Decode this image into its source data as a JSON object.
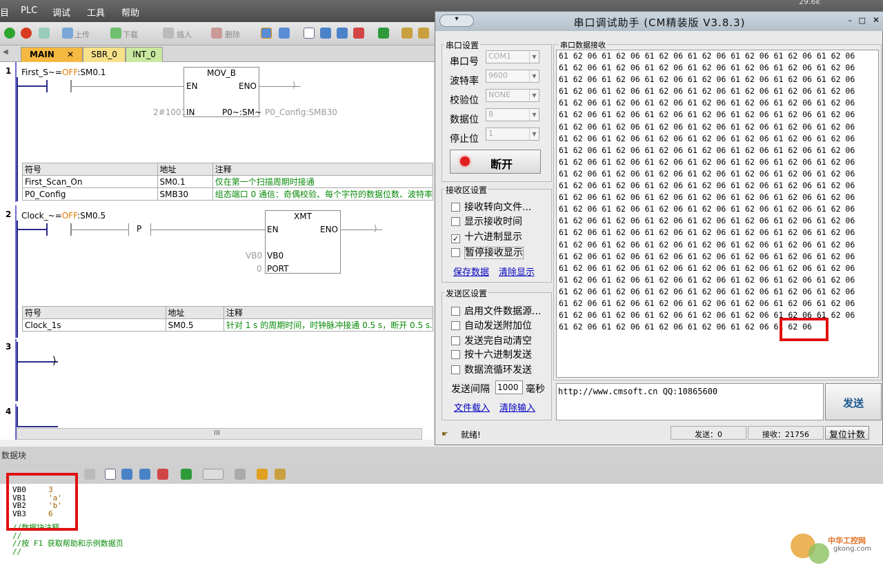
{
  "menu": {
    "partial_left": "目",
    "items": [
      "PLC",
      "调试",
      "工具",
      "帮助"
    ],
    "overlay_value": "29.6k"
  },
  "toolbar": {
    "upload": "上传",
    "download": "下载",
    "insert": "插入",
    "delete": "删除"
  },
  "tabs": [
    "MAIN",
    "SBR_0",
    "INT_0"
  ],
  "networks": [
    {
      "number": "1",
      "contact": "First_S~=OFF:SM0.1",
      "block": "MOV_B",
      "en": "EN",
      "eno": "ENO",
      "in_value": "2#1001",
      "in_pin": "IN",
      "out_pin": "P0~:SM~",
      "out_value": "P0_Config:SMB30",
      "symbols": {
        "headers": [
          "符号",
          "地址",
          "注释"
        ],
        "rows": [
          [
            "First_Scan_On",
            "SM0.1",
            "仅在第一个扫描周期时接通"
          ],
          [
            "P0_Config",
            "SMB30",
            "组态端口 0 通信：奇偶校验、每个字符的数据位数、波特率"
          ]
        ]
      }
    },
    {
      "number": "2",
      "contact": "Clock_~=OFF:SM0.5",
      "edge": "P",
      "block": "XMT",
      "en": "EN",
      "eno": "ENO",
      "in1_value": "VB0",
      "in1_pin": "VB0",
      "in2_value": "0",
      "in2_pin": "PORT",
      "symbols": {
        "headers": [
          "符号",
          "地址",
          "注释"
        ],
        "rows": [
          [
            "Clock_1s",
            "SM0.5",
            "针对 1 s 的周期时间，时钟脉冲接通 0.5 s，断开 0.5 s."
          ]
        ]
      }
    },
    {
      "number": "3"
    },
    {
      "number": "4"
    }
  ],
  "scrollbar_grip": "III",
  "datablock": {
    "title": "数据块",
    "lines": [
      {
        "addr": "VB0",
        "val": "3"
      },
      {
        "addr": "VB1",
        "val": "'a'"
      },
      {
        "addr": "VB2",
        "val": "'b'"
      },
      {
        "addr": "VB3",
        "val": "6"
      }
    ],
    "comments": [
      "//数据块注释",
      "//",
      "//按 F1 获取帮助和示例数据页",
      "//"
    ]
  },
  "serial": {
    "title": "串口调试助手 (CM精装版 V3.8.3)",
    "settings_group": "串口设置",
    "labels": [
      "串口号",
      "波特率",
      "校验位",
      "数据位",
      "停止位"
    ],
    "values": [
      "COM1",
      "9600",
      "NONE",
      "8",
      "1"
    ],
    "disconnect": "断开",
    "rx_group": "接收区设置",
    "rx_options": [
      {
        "label": "接收转向文件...",
        "checked": false
      },
      {
        "label": "显示接收时间",
        "checked": false
      },
      {
        "label": "十六进制显示",
        "checked": true
      },
      {
        "label": "暂停接收显示",
        "checked": false
      }
    ],
    "save_data": "保存数据",
    "clear_display": "清除显示",
    "tx_group": "发送区设置",
    "tx_options": [
      {
        "label": "启用文件数据源...",
        "checked": false
      },
      {
        "label": "自动发送附加位",
        "checked": false
      },
      {
        "label": "发送完自动清空",
        "checked": false
      },
      {
        "label": "按十六进制发送",
        "checked": false
      },
      {
        "label": "数据流循环发送",
        "checked": false
      }
    ],
    "interval_label": "发送间隔",
    "interval_value": "1000",
    "interval_unit": "毫秒",
    "file_load": "文件载入",
    "clear_input": "清除输入",
    "rx_data_label": "串口数据接收",
    "rx_line": "61 62 06 61 62 06 61 62 06 61 62 06 61 62 06 61 62 06 61 62 06",
    "rx_line_count": 24,
    "rx_last_line": "61 62 06 61 62 06 61 62 06 61 62 06 61 62 06 61 62 06",
    "tx_text": "http://www.cmsoft.cn QQ:10865600",
    "send": "发送",
    "status": "就绪!",
    "sent_count": "发送：0",
    "recv_count": "接收：21756",
    "reset_count": "复位计数"
  },
  "watermark": {
    "name": "中华工控网",
    "url": "gkong.com"
  },
  "colors": {
    "highlight": "#e01010",
    "comment_green": "#0a8a0a",
    "link_blue": "#0000c0",
    "contact_orange": "#e07a00"
  }
}
